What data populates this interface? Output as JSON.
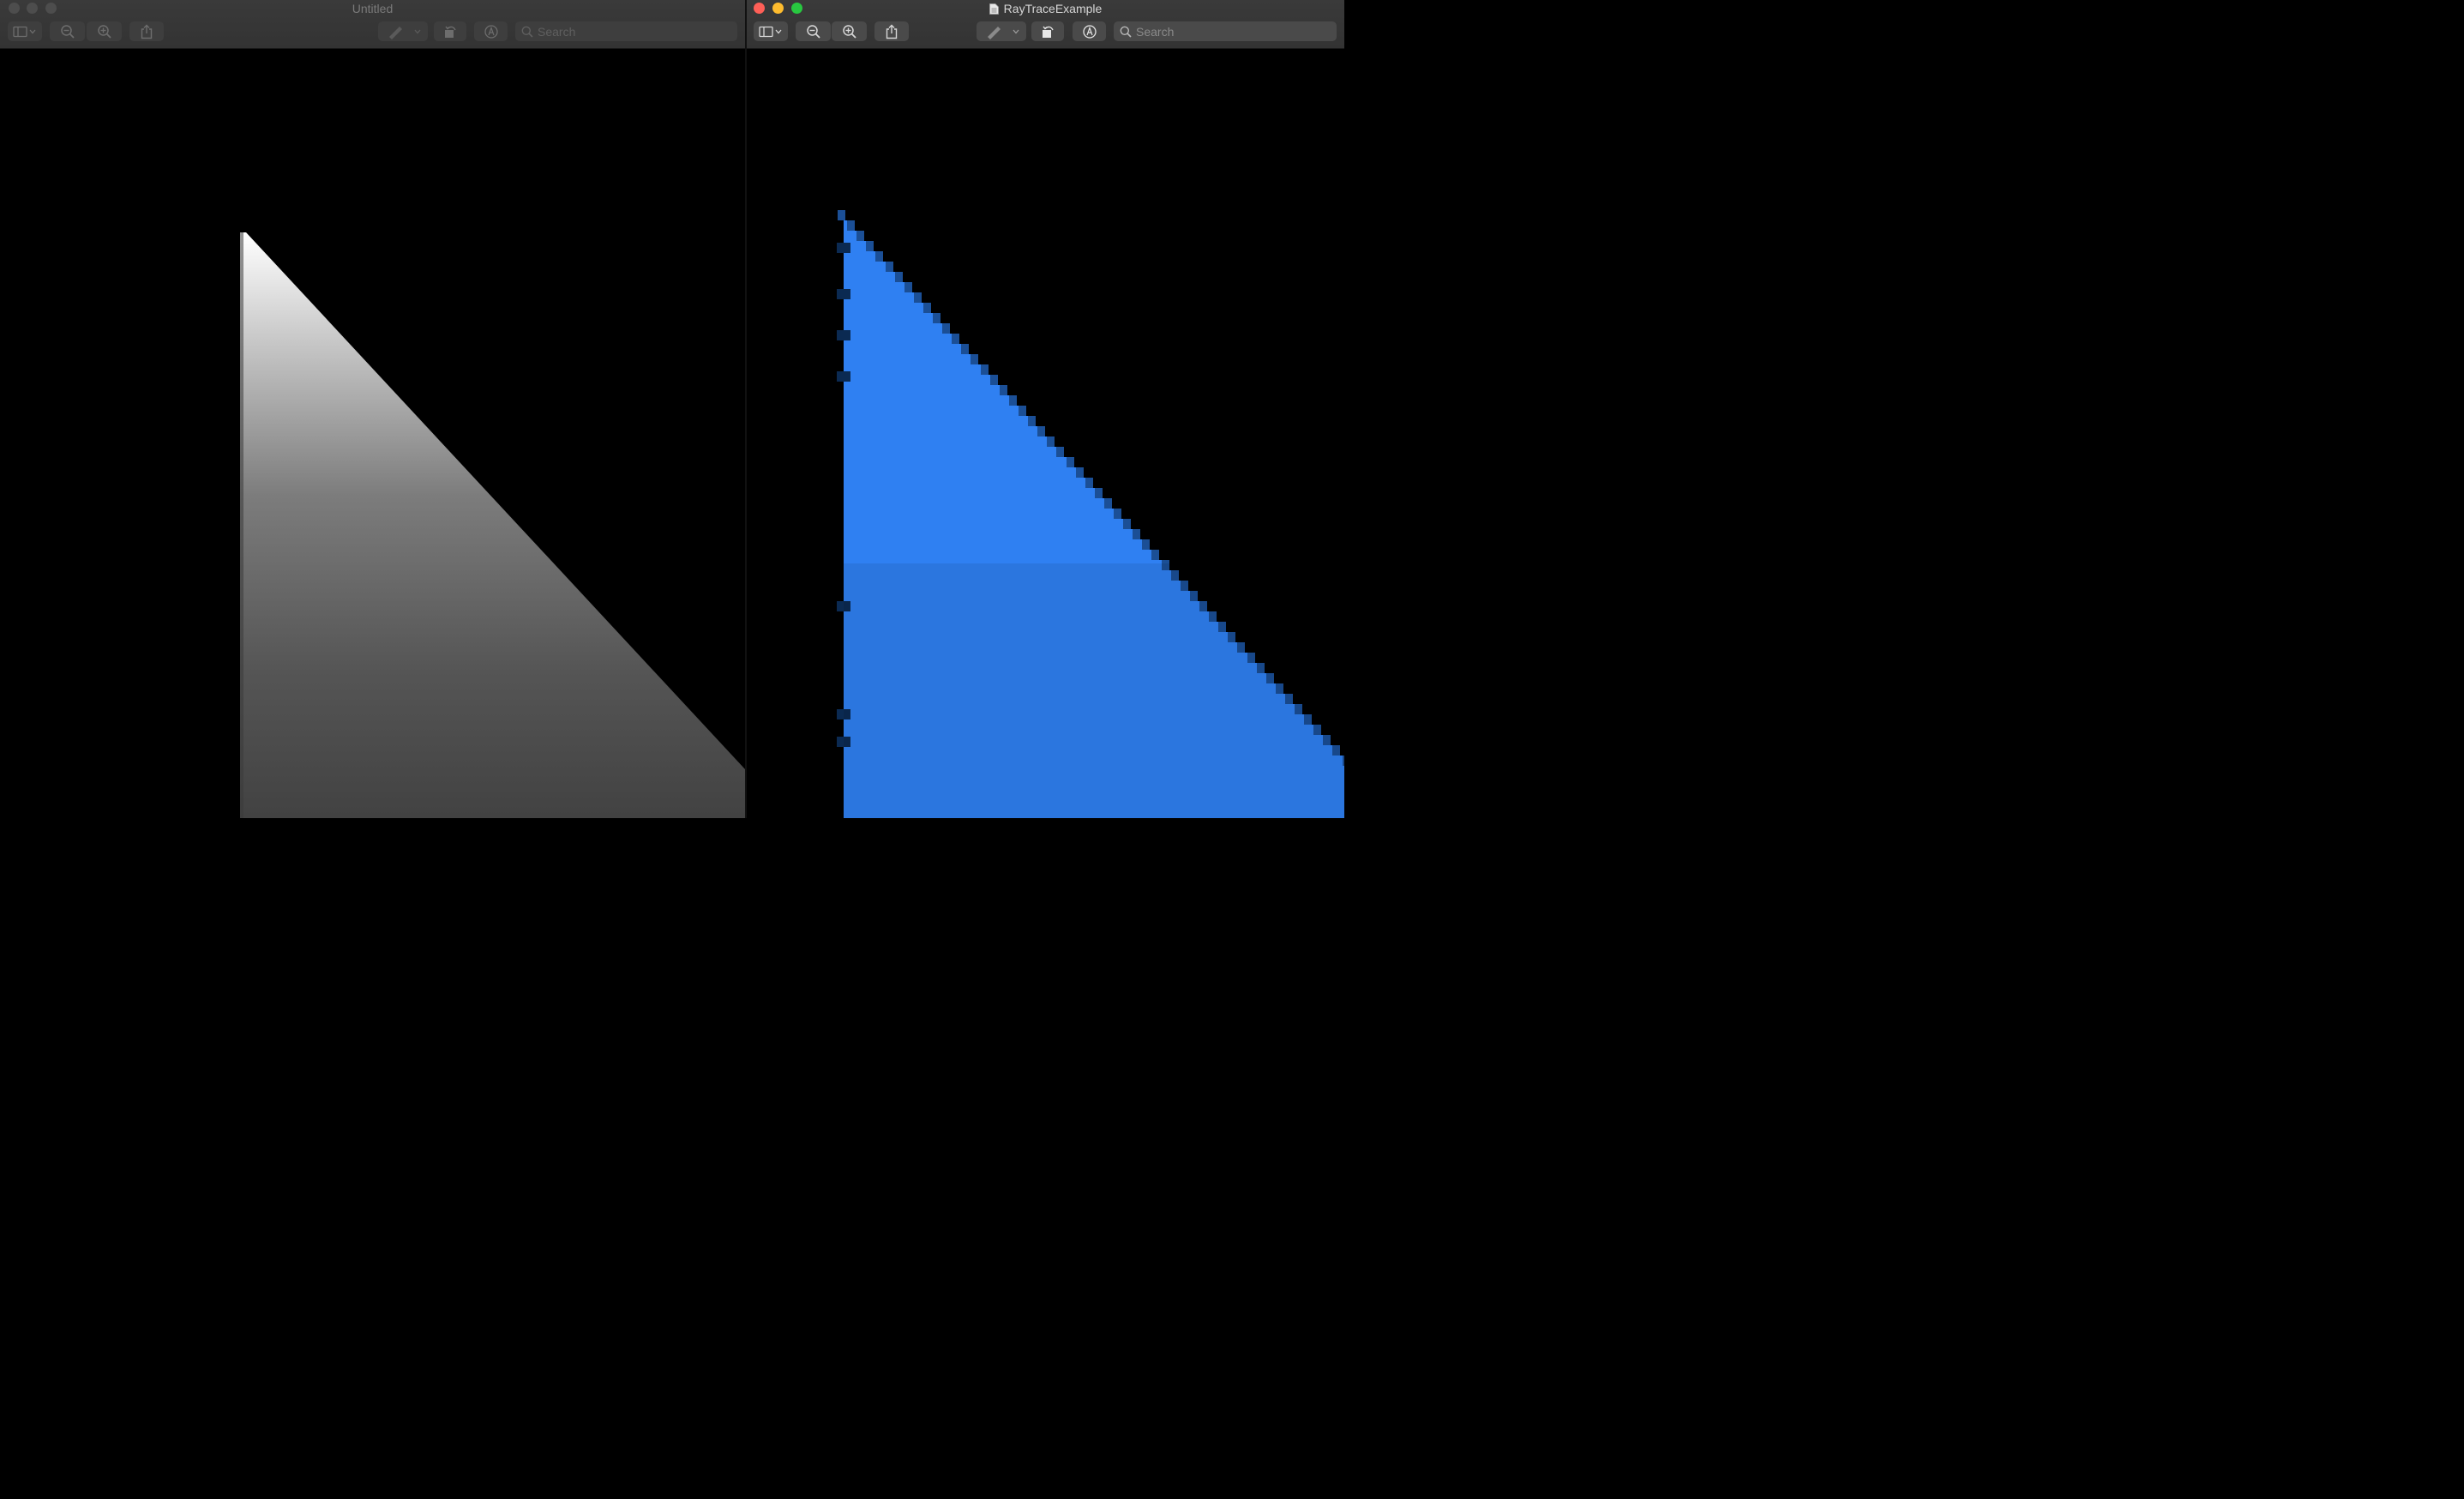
{
  "colors": {
    "titlebar": "#353535",
    "close": "#fe5f57",
    "minimize": "#febc2e",
    "zoom": "#28c840",
    "inactive_dot": "#4d4d4d",
    "render_blue": "#2f80f2",
    "render_white": "#ffffff"
  },
  "windows": [
    {
      "title": "Untitled",
      "active": false,
      "toolbar": {
        "sidebar": "sidebar-toggle-icon",
        "zoom_out": "zoom-out-icon",
        "zoom_in": "zoom-in-icon",
        "share": "share-icon",
        "markup": "pen-markup-icon",
        "rotate": "rotate-left-icon",
        "annotate": "annotate-circle-icon",
        "search_placeholder": "Search"
      },
      "content": "white-to-gray gradient triangle"
    },
    {
      "title": "RayTraceExample",
      "active": true,
      "title_icon": "document-icon",
      "toolbar": {
        "sidebar": "sidebar-toggle-icon",
        "zoom_out": "zoom-out-icon",
        "zoom_in": "zoom-in-icon",
        "share": "share-icon",
        "markup": "pen-markup-icon",
        "rotate": "rotate-left-icon",
        "annotate": "annotate-circle-icon",
        "search_placeholder": "Search"
      },
      "content": "blue pixelated triangle"
    }
  ]
}
